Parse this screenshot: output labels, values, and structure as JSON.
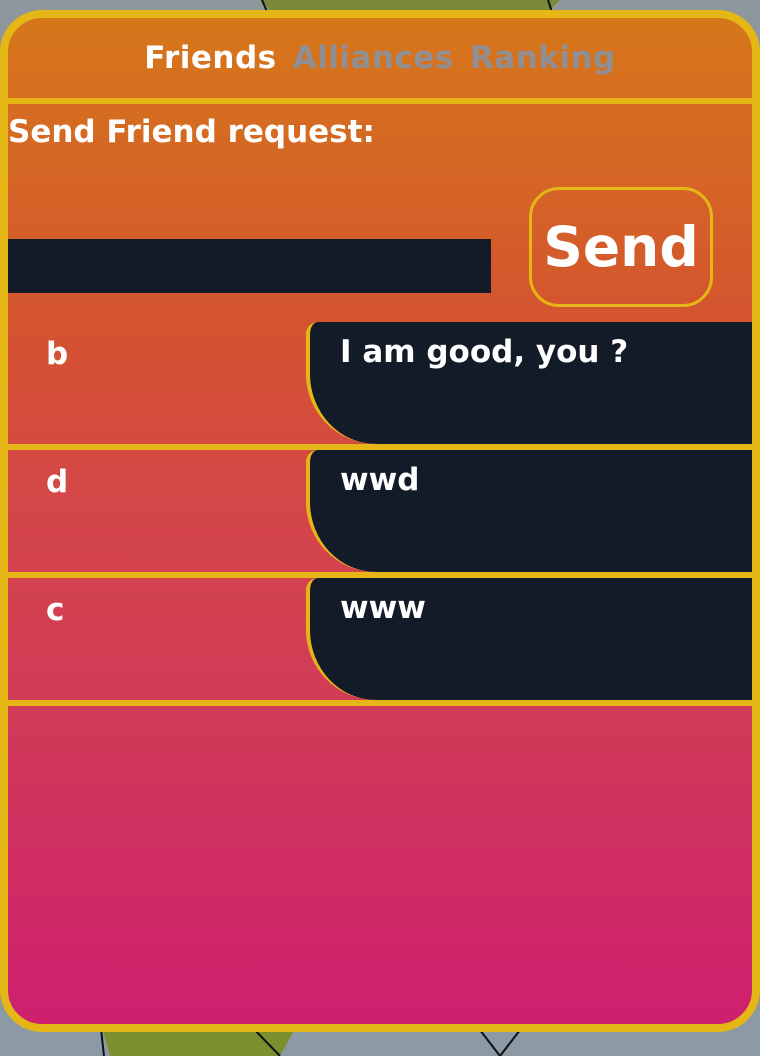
{
  "colors": {
    "accent_border": "#e5b716",
    "panel_top": "#d6771a",
    "panel_bottom": "#cf1f6f",
    "dark_field": "#131a28",
    "tab_inactive": "#8f8f94",
    "text": "#ffffff"
  },
  "tabs": [
    {
      "label": "Friends",
      "active": true
    },
    {
      "label": "Alliances",
      "active": false
    },
    {
      "label": "Ranking",
      "active": false
    }
  ],
  "friend_request": {
    "label": "Send Friend request:",
    "input_value": "",
    "send_label": "Send"
  },
  "friends": [
    {
      "name": "b",
      "last_message": "I am good, you ?"
    },
    {
      "name": "d",
      "last_message": "wwd"
    },
    {
      "name": "c",
      "last_message": "www"
    }
  ]
}
